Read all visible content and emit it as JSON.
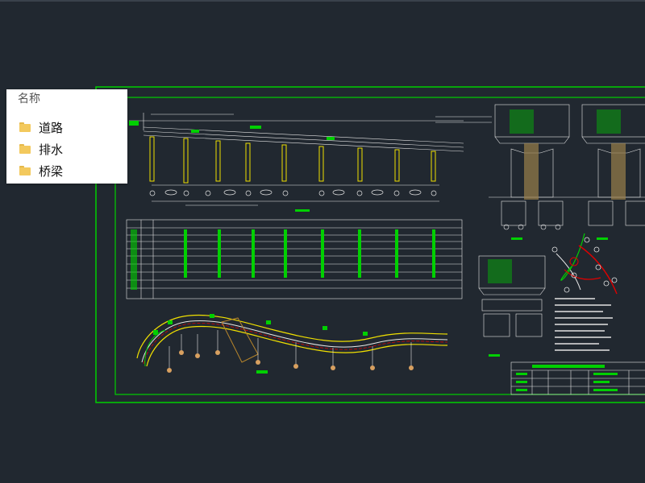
{
  "file_panel": {
    "header": "名称",
    "items": [
      {
        "label": "道路",
        "icon": "folder-icon"
      },
      {
        "label": "排水",
        "icon": "folder-icon"
      },
      {
        "label": "桥梁",
        "icon": "folder-icon"
      }
    ]
  },
  "colors": {
    "background": "#212830",
    "frame": "#00d000",
    "lines": "#e6e6e6",
    "elevation": "#f0e000",
    "route": "#e00000"
  }
}
